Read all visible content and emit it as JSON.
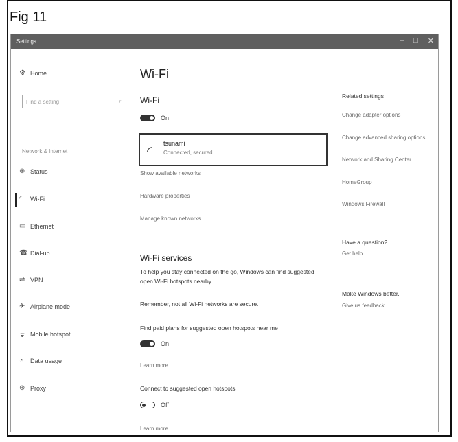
{
  "figure_label": "Fig 11",
  "window": {
    "title": "Settings",
    "controls": [
      "–",
      "□",
      "✕"
    ]
  },
  "sidebar": {
    "home": "Home",
    "search_placeholder": "Find a setting",
    "category": "Network & Internet",
    "items": [
      {
        "label": "Status",
        "icon": "status-icon"
      },
      {
        "label": "Wi-Fi",
        "icon": "wifi-icon",
        "selected": true
      },
      {
        "label": "Ethernet",
        "icon": "ethernet-icon"
      },
      {
        "label": "Dial-up",
        "icon": "dialup-icon"
      },
      {
        "label": "VPN",
        "icon": "vpn-icon"
      },
      {
        "label": "Airplane mode",
        "icon": "airplane-icon"
      },
      {
        "label": "Mobile hotspot",
        "icon": "hotspot-icon"
      },
      {
        "label": "Data usage",
        "icon": "data-usage-icon"
      },
      {
        "label": "Proxy",
        "icon": "proxy-icon"
      }
    ]
  },
  "main": {
    "title": "Wi-Fi",
    "wifi_section": "Wi-Fi",
    "wifi_toggle": "On",
    "network": {
      "name": "tsunami",
      "status": "Connected, secured"
    },
    "links": [
      "Show available networks",
      "Hardware properties",
      "Manage known networks"
    ],
    "services_title": "Wi-Fi services",
    "services_text": "To help you stay connected on the go, Windows can find suggested open Wi-Fi hotspots nearby.",
    "remember_text": "Remember, not all Wi-Fi networks are secure.",
    "paid_plans_label": "Find paid plans for suggested open hotspots near me",
    "paid_plans_toggle": "On",
    "learn_more_1": "Learn more",
    "connect_label": "Connect to suggested open hotspots",
    "connect_toggle": "Off",
    "learn_more_2": "Learn more"
  },
  "right": {
    "related_title": "Related settings",
    "related_links": [
      "Change adapter options",
      "Change advanced sharing options",
      "Network and Sharing Center",
      "HomeGroup",
      "Windows Firewall"
    ],
    "question_title": "Have a question?",
    "get_help": "Get help",
    "better_title": "Make Windows better.",
    "feedback": "Give us feedback"
  }
}
